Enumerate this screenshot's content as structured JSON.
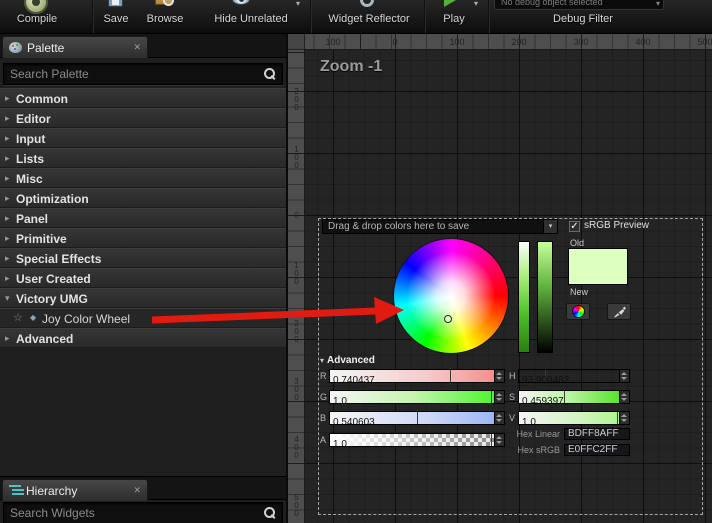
{
  "icons": {
    "caret_right": "▸",
    "caret_down": "▾",
    "close": "✕",
    "check": "✓",
    "star": "☆",
    "diamond": "◆",
    "dropdown": "▾"
  },
  "toolbar": {
    "compile": "Compile",
    "save": "Save",
    "browse": "Browse",
    "hide_unrelated": "Hide Unrelated",
    "widget_reflector": "Widget Reflector",
    "play": "Play",
    "debug_dropdown": "No debug object selected",
    "debug_filter": "Debug Filter"
  },
  "palette": {
    "tab": "Palette",
    "search_placeholder": "Search Palette",
    "categories": [
      "Common",
      "Editor",
      "Input",
      "Lists",
      "Misc",
      "Optimization",
      "Panel",
      "Primitive",
      "Special Effects",
      "User Created"
    ],
    "victory_label": "Victory UMG",
    "victory_child": "Joy Color Wheel",
    "advanced": "Advanced"
  },
  "hierarchy": {
    "tab": "Hierarchy",
    "search_placeholder": "Search Widgets"
  },
  "canvas": {
    "zoom": "Zoom -1",
    "ruler_top": [
      "100",
      "0",
      "100",
      "200",
      "300",
      "400",
      "500"
    ],
    "ruler_left": [
      "200",
      "100",
      "0",
      "100",
      "200",
      "300",
      "400",
      "500"
    ]
  },
  "picker": {
    "dragdrop": "Drag & drop colors here to save",
    "srgb": "sRGB Preview",
    "old": "Old",
    "new": "New",
    "advanced": "Advanced",
    "r_label": "R",
    "r": "0.740437",
    "g_label": "G",
    "g": "1.0",
    "b_label": "B",
    "b": "0.540603",
    "a_label": "A",
    "a": "1.0",
    "h_label": "H",
    "h": "93.900482",
    "s_label": "S",
    "s": "0.459397",
    "v_label": "V",
    "v": "1.0",
    "hex_linear_label": "Hex Linear",
    "hex_linear": "BDFF8AFF",
    "hex_srgb_label": "Hex sRGB",
    "hex_srgb": "E0FFC2FF",
    "current_color": "#DDFFC0"
  },
  "colors": {
    "arrow": "#e01b12",
    "accent_green": "#4ef52e"
  }
}
